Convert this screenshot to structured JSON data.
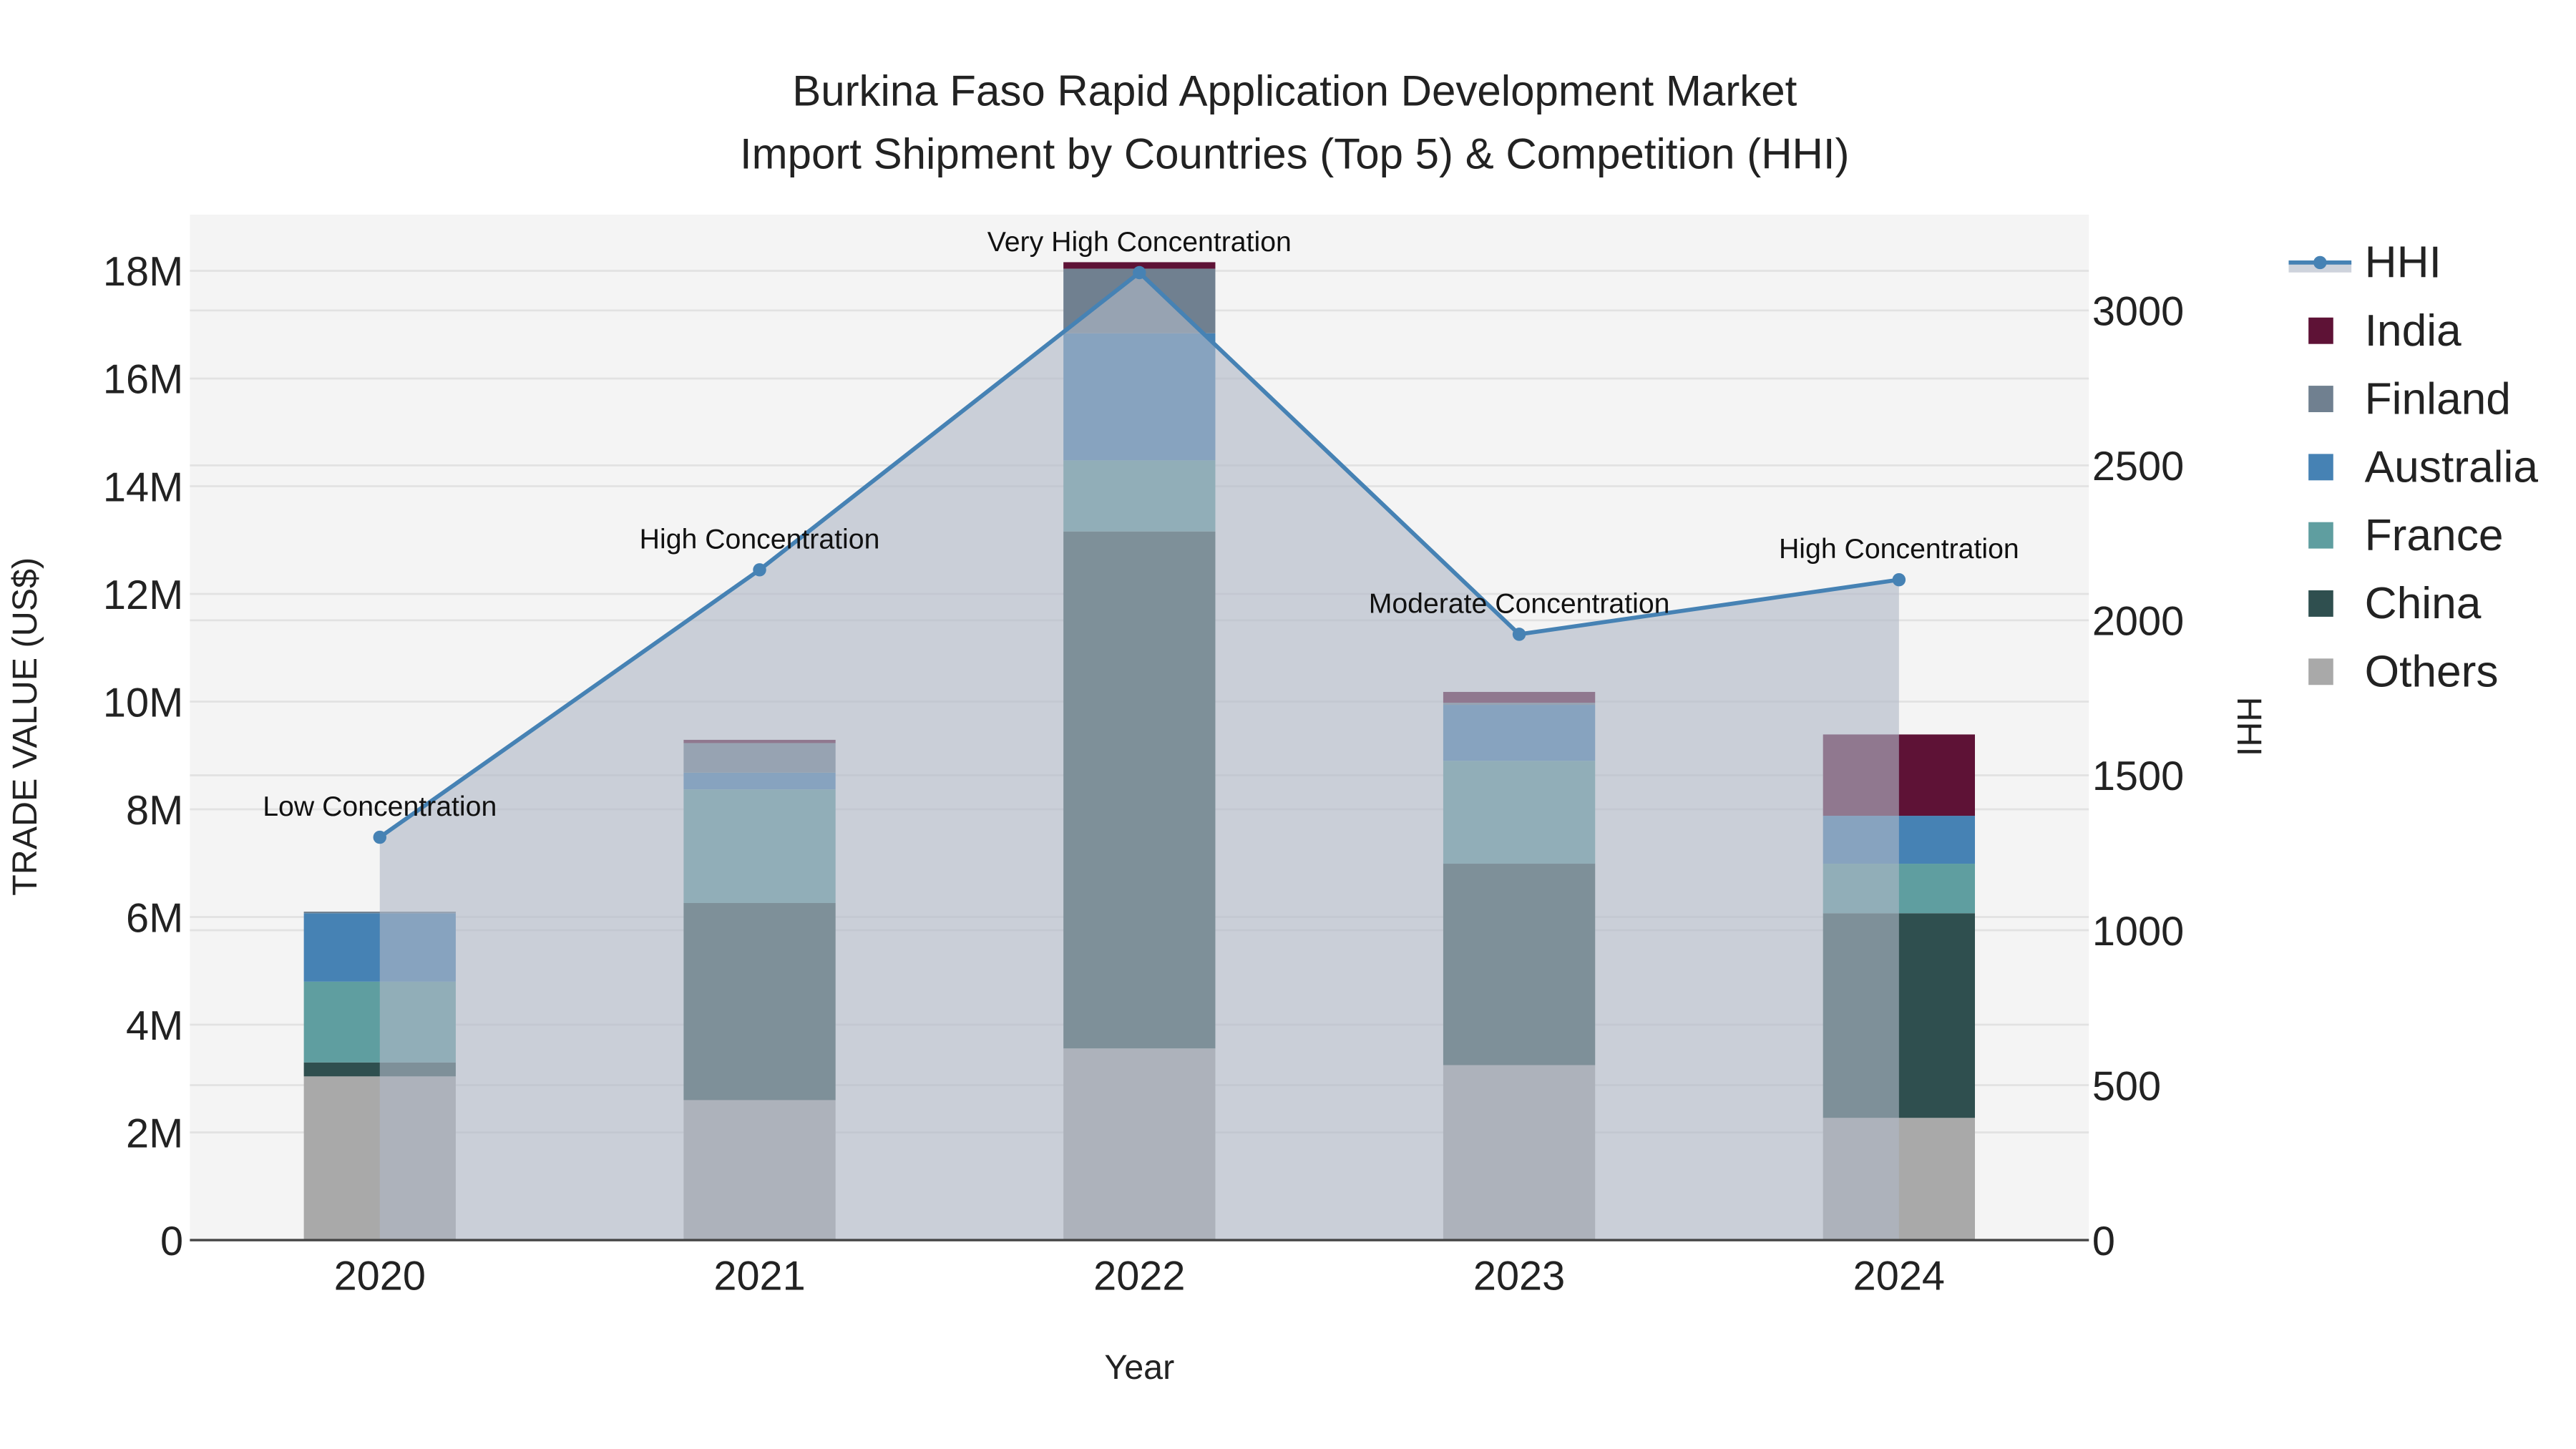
{
  "chart_data": {
    "type": "bar",
    "title_line1": "Burkina Faso Rapid Application Development Market",
    "title_line2": "Import Shipment by Countries (Top 5) & Competition (HHI)",
    "xlabel": "Year",
    "ylabel": "TRADE VALUE (US$)",
    "y2label": "HHI",
    "categories": [
      "2020",
      "2021",
      "2022",
      "2023",
      "2024"
    ],
    "ylim": [
      0,
      19000000
    ],
    "y2lim": [
      0,
      3300
    ],
    "yticks": [
      0,
      2000000,
      4000000,
      6000000,
      8000000,
      10000000,
      12000000,
      14000000,
      16000000,
      18000000
    ],
    "ytick_labels": [
      "0",
      "2M",
      "4M",
      "6M",
      "8M",
      "10M",
      "12M",
      "14M",
      "16M",
      "18M"
    ],
    "y2ticks": [
      0,
      500,
      1000,
      1500,
      2000,
      2500,
      3000
    ],
    "y2tick_labels": [
      "0",
      "500",
      "1000",
      "1500",
      "2000",
      "2500",
      "3000"
    ],
    "series": [
      {
        "name": "Others",
        "color": "#a9a9a9",
        "values": [
          3040000,
          2600000,
          3560000,
          3250000,
          2270000
        ]
      },
      {
        "name": "China",
        "color": "#2f4f4f",
        "values": [
          260000,
          3660000,
          9600000,
          3740000,
          3800000
        ]
      },
      {
        "name": "France",
        "color": "#5f9ea0",
        "values": [
          1500000,
          2110000,
          1320000,
          1910000,
          920000
        ]
      },
      {
        "name": "Australia",
        "color": "#4682b4",
        "values": [
          1270000,
          310000,
          2360000,
          1040000,
          890000
        ]
      },
      {
        "name": "Finland",
        "color": "#708090",
        "values": [
          30000,
          550000,
          1200000,
          40000,
          0
        ]
      },
      {
        "name": "India",
        "color": "#5e1236",
        "values": [
          0,
          60000,
          120000,
          200000,
          1510000
        ]
      }
    ],
    "hhi": {
      "name": "HHI",
      "color": "#4682b4",
      "values": [
        1300,
        2163,
        3122,
        1955,
        2131
      ],
      "annotations": [
        "Low Concentration",
        "High Concentration",
        "Very High Concentration",
        "Moderate Concentration",
        "High Concentration"
      ]
    },
    "legend_position": "right",
    "legend": [
      "HHI",
      "India",
      "Finland",
      "Australia",
      "France",
      "China",
      "Others"
    ],
    "grid": true
  }
}
